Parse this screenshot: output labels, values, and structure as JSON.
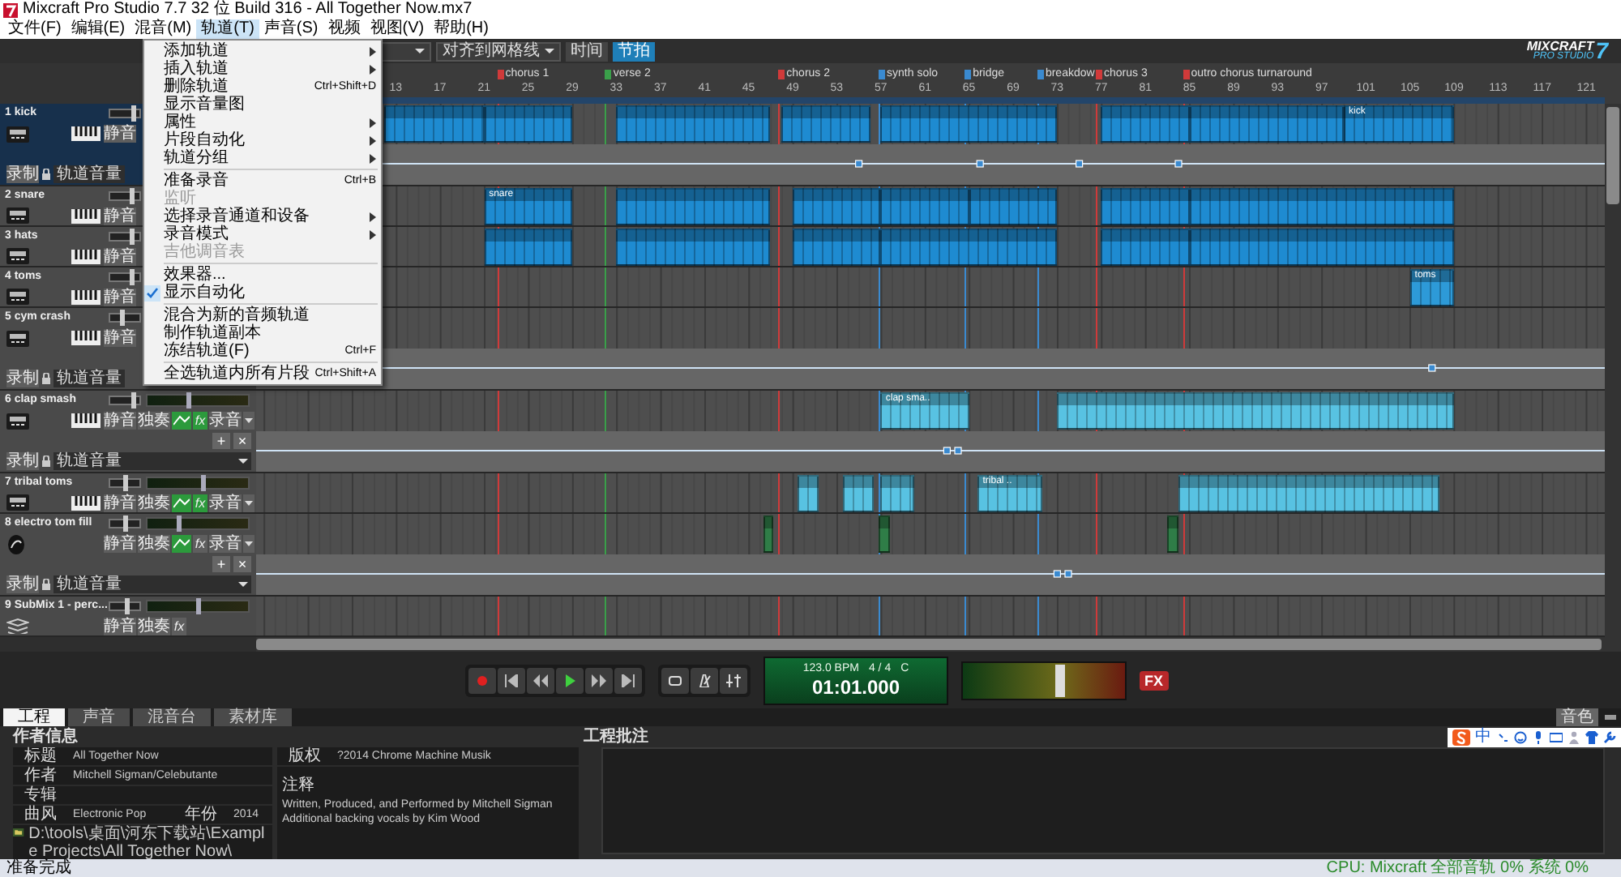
{
  "window": {
    "title": "Mixcraft Pro Studio 7.7 32 位 Build 316 - All Together Now.mx7"
  },
  "menu_bar": [
    {
      "label": "文件(F)",
      "selected": false
    },
    {
      "label": "编辑(E)",
      "selected": false
    },
    {
      "label": "混音(M)",
      "selected": false
    },
    {
      "label": "轨道(T)",
      "selected": true
    },
    {
      "label": "声音(S)",
      "selected": false
    },
    {
      "label": "视频",
      "selected": false
    },
    {
      "label": "视图(V)",
      "selected": false
    },
    {
      "label": "帮助(H)",
      "selected": false
    }
  ],
  "track_menu": {
    "items": [
      {
        "kind": "item",
        "label": "添加轨道",
        "submenu": true,
        "disabled": false,
        "checked": false
      },
      {
        "kind": "item",
        "label": "插入轨道",
        "submenu": true,
        "disabled": false,
        "checked": false
      },
      {
        "kind": "item",
        "label": "删除轨道",
        "shortcut": "Ctrl+Shift+D",
        "submenu": false,
        "disabled": false,
        "checked": false
      },
      {
        "kind": "item",
        "label": "显示音量图",
        "submenu": false,
        "disabled": false,
        "checked": false
      },
      {
        "kind": "item",
        "label": "属性",
        "submenu": true,
        "disabled": false,
        "checked": false
      },
      {
        "kind": "item",
        "label": "片段自动化",
        "submenu": true,
        "disabled": false,
        "checked": false
      },
      {
        "kind": "item",
        "label": "轨道分组",
        "submenu": true,
        "disabled": false,
        "checked": false
      },
      {
        "kind": "separator"
      },
      {
        "kind": "item",
        "label": "准备录音",
        "shortcut": "Ctrl+B",
        "submenu": false,
        "disabled": false,
        "checked": false
      },
      {
        "kind": "item",
        "label": "监听",
        "submenu": false,
        "disabled": true,
        "checked": false
      },
      {
        "kind": "item",
        "label": "选择录音通道和设备",
        "submenu": true,
        "disabled": false,
        "checked": false
      },
      {
        "kind": "item",
        "label": "录音模式",
        "submenu": true,
        "disabled": false,
        "checked": false
      },
      {
        "kind": "item",
        "label": "吉他调音表",
        "submenu": false,
        "disabled": true,
        "checked": false
      },
      {
        "kind": "separator"
      },
      {
        "kind": "item",
        "label": "效果器...",
        "submenu": false,
        "disabled": false,
        "checked": false
      },
      {
        "kind": "item",
        "label": "显示自动化",
        "submenu": false,
        "disabled": false,
        "checked": true
      },
      {
        "kind": "separator"
      },
      {
        "kind": "item",
        "label": "混合为新的音频轨道",
        "submenu": false,
        "disabled": false,
        "checked": false
      },
      {
        "kind": "item",
        "label": "制作轨道副本",
        "submenu": false,
        "disabled": false,
        "checked": false
      },
      {
        "kind": "item",
        "label": "冻结轨道(F)",
        "shortcut": "Ctrl+F",
        "submenu": false,
        "disabled": false,
        "checked": false
      },
      {
        "kind": "separator"
      },
      {
        "kind": "item",
        "label": "全选轨道内所有片段",
        "shortcut": "Ctrl+Shift+A",
        "submenu": false,
        "disabled": false,
        "checked": false
      }
    ]
  },
  "toolbar": {
    "snap_dropdown": "对齐到网格线",
    "time_modes": [
      {
        "label": "时间",
        "selected": false
      },
      {
        "label": "节拍",
        "selected": true
      }
    ],
    "logo": {
      "name": "MIXCRAFT",
      "edition": "PRO STUDIO",
      "version": "7"
    }
  },
  "ruler": {
    "markers": [
      {
        "label": "chorus 1",
        "color": "#d03a3a"
      },
      {
        "label": "verse 2",
        "color": "#3aa04a"
      },
      {
        "label": "chorus 2",
        "color": "#d03a3a"
      },
      {
        "label": "synth solo",
        "color": "#3a8ad0"
      },
      {
        "label": "bridge",
        "color": "#3a8ad0"
      },
      {
        "label": "breakdow",
        "color": "#3a8ad0"
      },
      {
        "label": "chorus 3",
        "color": "#d03a3a"
      },
      {
        "label": "outro chorus turnaround",
        "color": "#d03a3a"
      }
    ],
    "bar_numbers": [
      "13",
      "17",
      "21",
      "25",
      "29",
      "33",
      "37",
      "41",
      "45",
      "49",
      "53",
      "57",
      "61",
      "65",
      "69",
      "73",
      "77",
      "81",
      "85",
      "89",
      "93",
      "97",
      "101",
      "105",
      "109",
      "113",
      "117",
      "121"
    ]
  },
  "tracks": [
    {
      "name": "1 kick",
      "kind": "instrument",
      "selected": true,
      "color": "#1e8bd1",
      "volume": {
        "level": 0.75
      },
      "buttons": [
        {
          "kind": "text",
          "label": "静音"
        }
      ],
      "automation": {
        "record": "录制",
        "lane": "轨道音量",
        "menu": false
      },
      "clip_labels": [
        "kick"
      ]
    },
    {
      "name": "2 snare",
      "kind": "instrument",
      "selected": false,
      "color": "#1e8bd1",
      "volume": {
        "level": 0.7
      },
      "buttons": [
        {
          "kind": "text",
          "label": "静音"
        }
      ],
      "clip_labels": [
        "snare"
      ]
    },
    {
      "name": "3 hats",
      "kind": "instrument",
      "selected": false,
      "color": "#1e8bd1",
      "volume": {
        "level": 0.7
      },
      "buttons": [
        {
          "kind": "text",
          "label": "静音"
        }
      ]
    },
    {
      "name": "4 toms",
      "kind": "instrument",
      "selected": false,
      "color": "#2d9ad8",
      "volume": {
        "level": 0.72
      },
      "buttons": [
        {
          "kind": "text",
          "label": "静音"
        }
      ],
      "clip_labels": [
        "toms"
      ]
    },
    {
      "name": "5 cym crash",
      "kind": "instrument",
      "selected": false,
      "volume": {
        "level": 0.4
      },
      "buttons": [
        {
          "kind": "text",
          "label": "静音"
        }
      ],
      "automation": {
        "record": "录制",
        "lane": "轨道音量",
        "menu": false
      }
    },
    {
      "name": "6 clap smash",
      "kind": "instrument",
      "selected": false,
      "color": "#58c2e2",
      "volume": {
        "level": 0.75
      },
      "pan": {
        "level": 0.4
      },
      "buttons": [
        {
          "kind": "text",
          "label": "静音"
        },
        {
          "kind": "text",
          "label": "独奏"
        },
        {
          "kind": "automation",
          "on": true
        },
        {
          "kind": "fx",
          "label": "fx",
          "on": true
        },
        {
          "kind": "text",
          "label": "录音"
        },
        {
          "kind": "menu"
        }
      ],
      "automation": {
        "add": "+",
        "remove": "×",
        "record": "录制",
        "lane": "轨道音量",
        "menu": true
      },
      "clip_labels": [
        "clap sma.."
      ]
    },
    {
      "name": "7 tribal toms",
      "kind": "instrument",
      "selected": false,
      "color": "#58c2e2",
      "volume": {
        "level": 0.5
      },
      "pan": {
        "level": 0.55
      },
      "buttons": [
        {
          "kind": "text",
          "label": "静音"
        },
        {
          "kind": "text",
          "label": "独奏"
        },
        {
          "kind": "automation",
          "on": true
        },
        {
          "kind": "fx",
          "label": "fx",
          "on": true
        },
        {
          "kind": "text",
          "label": "录音"
        },
        {
          "kind": "menu"
        }
      ],
      "clip_labels": [
        "tribal .."
      ]
    },
    {
      "name": "8 electro tom fill",
      "kind": "audio",
      "selected": false,
      "color": "#2f7d47",
      "volume": {
        "level": 0.5
      },
      "pan": {
        "level": 0.3
      },
      "buttons": [
        {
          "kind": "text",
          "label": "静音"
        },
        {
          "kind": "text",
          "label": "独奏"
        },
        {
          "kind": "automation",
          "on": true
        },
        {
          "kind": "fx",
          "label": "fx",
          "on": false
        },
        {
          "kind": "text",
          "label": "录音"
        },
        {
          "kind": "menu"
        }
      ],
      "automation": {
        "add": "+",
        "remove": "×",
        "record": "录制",
        "lane": "轨道音量",
        "menu": true
      }
    },
    {
      "name": "9 SubMix 1 - perc...",
      "kind": "submix",
      "selected": false,
      "volume": {
        "level": 0.55
      },
      "pan": {
        "level": 0.5
      },
      "buttons": [
        {
          "kind": "text",
          "label": "静音"
        },
        {
          "kind": "text",
          "label": "独奏"
        },
        {
          "kind": "fx",
          "label": "fx",
          "on": false
        }
      ]
    }
  ],
  "transport": {
    "tempo": "123.0 BPM",
    "meter": "4 / 4",
    "key": "C",
    "position": "01:01.000",
    "master": {
      "level": 0.6
    },
    "fx_button": "FX"
  },
  "bottom_tabs": [
    {
      "label": "工程",
      "selected": true
    },
    {
      "label": "声音",
      "selected": false
    },
    {
      "label": "混音台",
      "selected": false
    },
    {
      "label": "素材库",
      "selected": false
    }
  ],
  "dock_button": "音色",
  "project": {
    "author_heading": "作者信息",
    "notes_heading": "工程批注",
    "title": {
      "label": "标题",
      "value": "All Together Now"
    },
    "artist": {
      "label": "作者",
      "value": "Mitchell Sigman/Celebutante"
    },
    "album": {
      "label": "专辑"
    },
    "genre": {
      "label": "曲风",
      "value": "Electronic Pop"
    },
    "year": {
      "label": "年份",
      "value": "2014"
    },
    "path": "D:\\tools\\桌面\\河东下载站\\Example Projects\\All Together Now\\",
    "copyright": {
      "label": "版权",
      "value": "?2014 Chrome Machine Musik"
    },
    "comments": {
      "label": "注释",
      "lines": [
        "Written, Produced, and Performed by Mitchell Sigman",
        "Additional backing vocals by Kim Wood"
      ]
    }
  },
  "ime_toolbar": {
    "mode": "中"
  },
  "status_bar": {
    "message": "准备完成",
    "cpu": "CPU: Mixcraft 全部音轨 0% 系统 0%"
  }
}
